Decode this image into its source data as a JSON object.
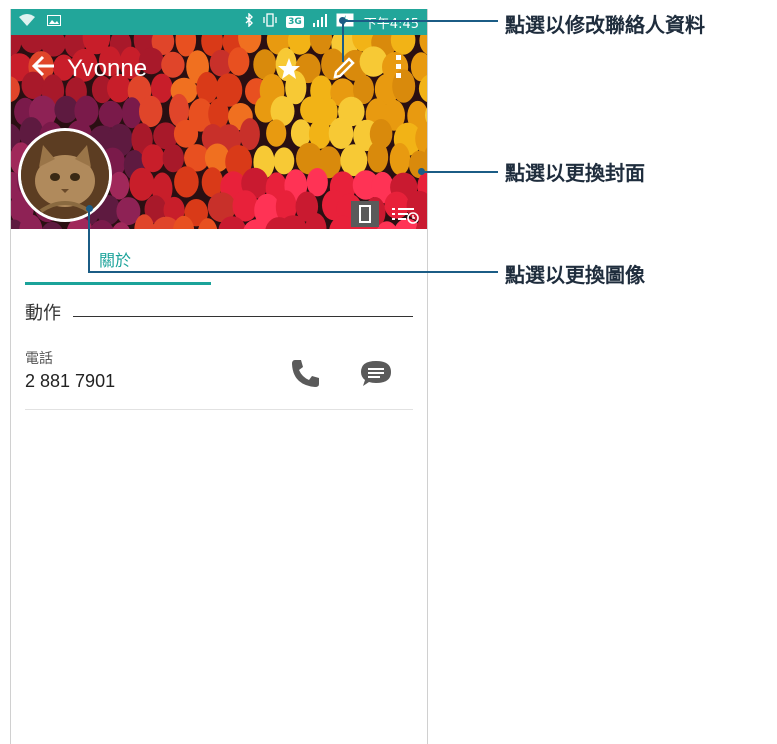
{
  "status_bar": {
    "time": "下午4:45",
    "network": "3G",
    "icons": [
      "wifi-icon",
      "image-icon",
      "bluetooth-icon",
      "vibrate-icon",
      "signal-icon",
      "battery-charging-icon"
    ]
  },
  "toolbar": {
    "contact_name": "Yvonne",
    "icons": [
      "back-arrow-icon",
      "star-icon",
      "pencil-icon",
      "more-vertical-icon"
    ]
  },
  "tabs": {
    "about": "關於"
  },
  "sections": {
    "actions": "動作"
  },
  "phone_entry": {
    "label": "電話",
    "number": "2 881 7901"
  },
  "callouts": {
    "edit_contact": "點選以修改聯絡人資料",
    "change_cover": "點選以更換封面",
    "change_photo": "點選以更換圖像"
  },
  "colors": {
    "status_bar": "#22a69a",
    "accent": "#1ba39a",
    "callout": "#1b5c85"
  }
}
